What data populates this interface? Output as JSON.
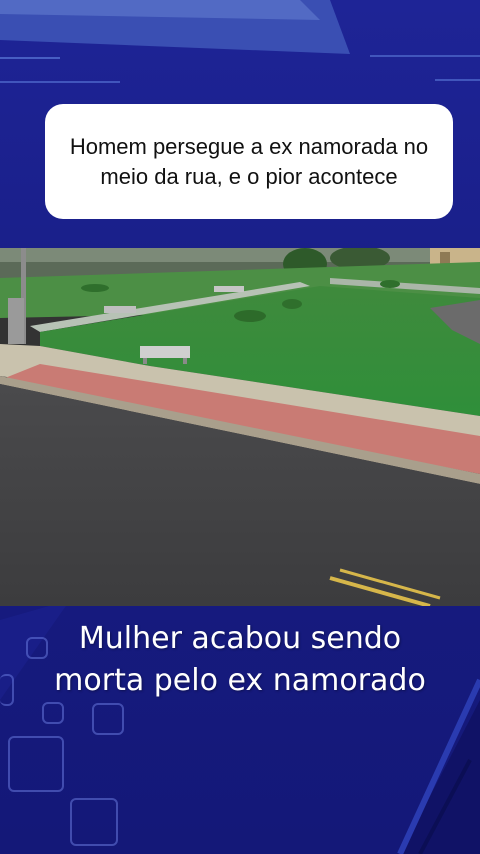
{
  "header": {
    "caption": "Homem persegue a ex namorada no meio da rua, e o pior acontece"
  },
  "video": {
    "description_icon": "cctv-street-footage"
  },
  "subtitle": {
    "line1": "Mulher acabou sendo",
    "line2": "morta pelo ex namorado"
  },
  "colors": {
    "background": "#1a1f8a",
    "caption_bg": "#ffffff",
    "subtitle_text": "#ffffff"
  }
}
